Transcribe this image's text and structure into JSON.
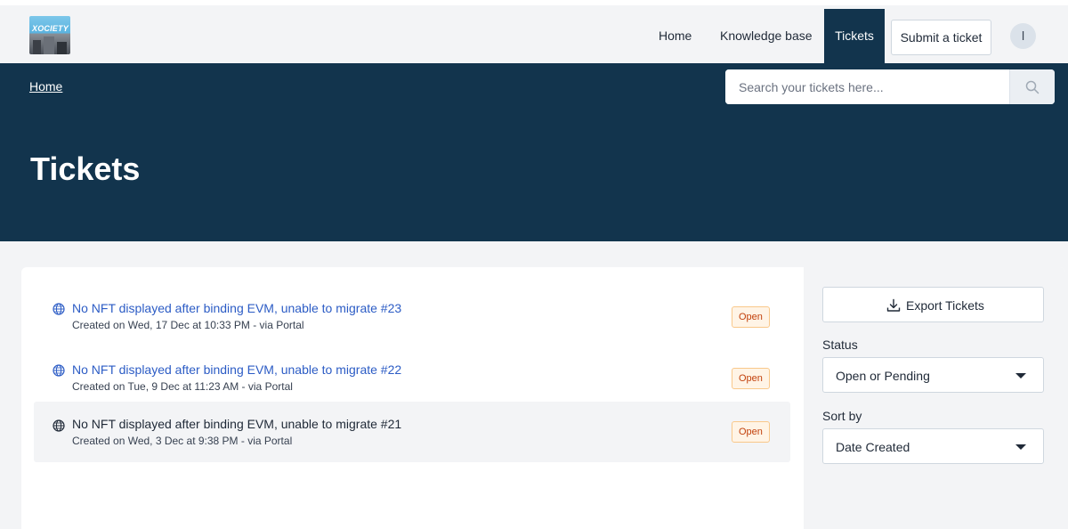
{
  "header": {
    "nav": {
      "home": "Home",
      "knowledge_base": "Knowledge base",
      "tickets": "Tickets",
      "submit_ticket": "Submit a ticket"
    },
    "avatar_initial": "l"
  },
  "hero": {
    "breadcrumb": "Home",
    "search_placeholder": "Search your tickets here...",
    "title": "Tickets"
  },
  "tickets": [
    {
      "title": "No NFT displayed after binding EVM, unable to migrate #23",
      "meta": "Created on Wed, 17 Dec at 10:33 PM - via Portal",
      "status": "Open"
    },
    {
      "title": "No NFT displayed after binding EVM, unable to migrate #22",
      "meta": "Created on Tue, 9 Dec at 11:23 AM - via Portal",
      "status": "Open"
    },
    {
      "title": "No NFT displayed after binding EVM, unable to migrate #21",
      "meta": "Created on Wed, 3 Dec at 9:38 PM - via Portal",
      "status": "Open"
    }
  ],
  "sidebar": {
    "export_label": "Export Tickets",
    "status_label": "Status",
    "status_value": "Open or Pending",
    "sort_label": "Sort by",
    "sort_value": "Date Created"
  },
  "colors": {
    "header_dark": "#12344d",
    "link_blue": "#2c5cc5",
    "badge_text": "#c2410c",
    "badge_bg": "#fff4e6"
  },
  "icons": [
    "logo",
    "search-icon",
    "globe-icon",
    "download-icon",
    "caret-down-icon"
  ]
}
